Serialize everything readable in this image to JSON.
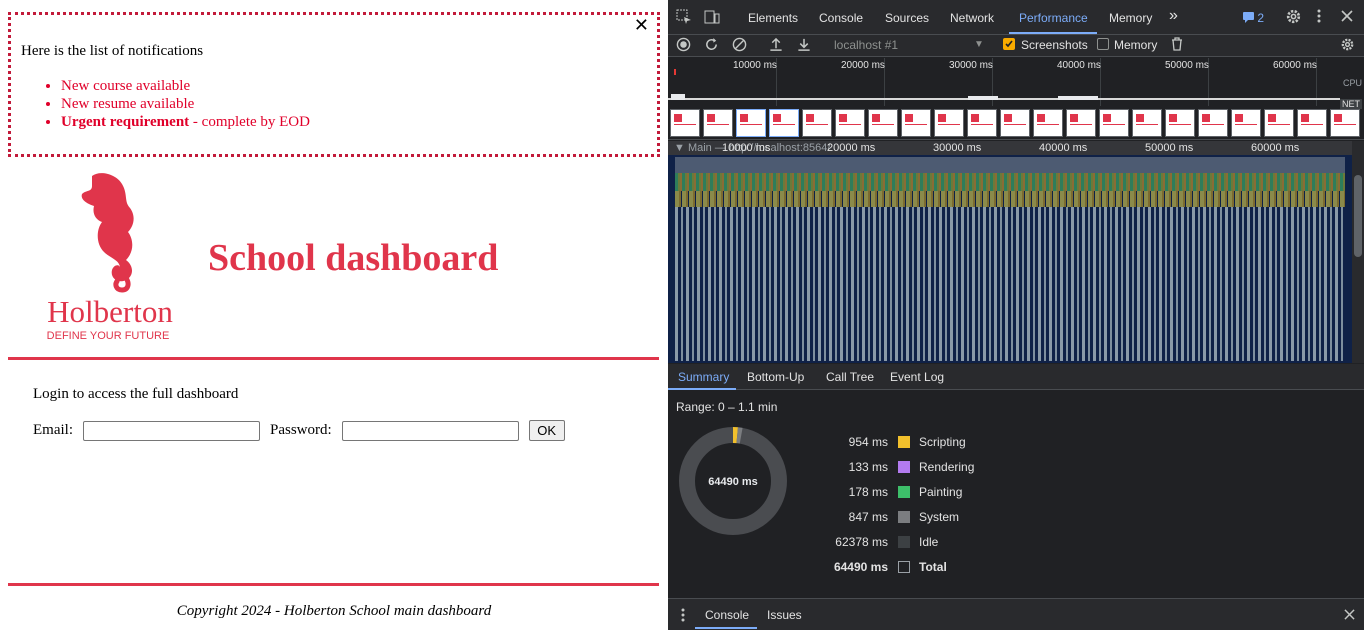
{
  "notifications": {
    "close_glyph": "✕",
    "intro": "Here is the list of notifications",
    "items": [
      {
        "text": "New course available"
      },
      {
        "text": "New resume available"
      },
      {
        "bold": "Urgent requirement",
        "rest": " - complete by EOD"
      }
    ]
  },
  "header": {
    "logo_brand": "Holberton",
    "logo_tagline": "DEFINE YOUR FUTURE",
    "title": "School dashboard"
  },
  "login": {
    "prompt": "Login to access the full dashboard",
    "email_label": "Email:",
    "password_label": "Password:",
    "email_value": "",
    "password_value": "",
    "ok_label": "OK"
  },
  "footer": {
    "text": "Copyright 2024 - Holberton School main dashboard"
  },
  "devtools": {
    "tabs": [
      "Elements",
      "Console",
      "Sources",
      "Network",
      "Performance",
      "Memory"
    ],
    "active_tab": "Performance",
    "more_glyph": "»",
    "issues_count": "2",
    "perf_toolbar": {
      "target": "localhost #1",
      "screenshots_label": "Screenshots",
      "screenshots_checked": true,
      "memory_label": "Memory",
      "memory_checked": false
    },
    "overview": {
      "ticks": [
        "10000 ms",
        "20000 ms",
        "30000 ms",
        "40000 ms",
        "50000 ms",
        "60000 ms"
      ],
      "cpu_label": "CPU",
      "net_label": "NET"
    },
    "flame": {
      "track_label": "▼ Main — http://localhost:8564/",
      "ticks": [
        "10000 ms",
        "20000 ms",
        "30000 ms",
        "40000 ms",
        "50000 ms",
        "60000 ms"
      ]
    },
    "bottom_tabs": [
      "Summary",
      "Bottom-Up",
      "Call Tree",
      "Event Log"
    ],
    "active_bottom_tab": "Summary",
    "summary": {
      "range": "Range: 0 – 1.1 min",
      "center_label": "64490 ms",
      "rows": [
        {
          "value": "954 ms",
          "name": "Scripting",
          "color": "#f2c02c"
        },
        {
          "value": "133 ms",
          "name": "Rendering",
          "color": "#b37bf0"
        },
        {
          "value": "178 ms",
          "name": "Painting",
          "color": "#3dbf6a"
        },
        {
          "value": "847 ms",
          "name": "System",
          "color": "#7b7d80"
        },
        {
          "value": "62378 ms",
          "name": "Idle",
          "color": "#3c4043"
        },
        {
          "value": "64490 ms",
          "name": "Total",
          "color": "transparent",
          "bold": true
        }
      ]
    },
    "drawer_tabs": [
      "Console",
      "Issues"
    ],
    "active_drawer_tab": "Console"
  }
}
